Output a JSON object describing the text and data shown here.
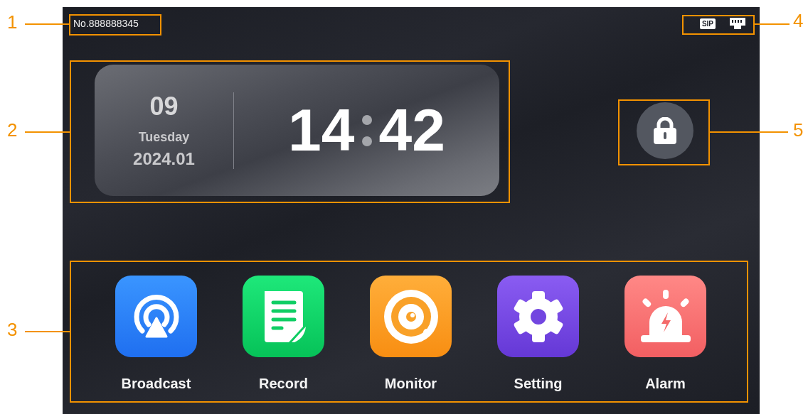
{
  "device_number": "No.888888345",
  "status_icons": [
    {
      "kind": "sip",
      "label": "SIP"
    },
    {
      "kind": "network"
    }
  ],
  "clock": {
    "day": "09",
    "weekday": "Tuesday",
    "year_month": "2024.01",
    "hour": "14",
    "minute": "42"
  },
  "apps": [
    {
      "kind": "broadcast",
      "label": "Broadcast"
    },
    {
      "kind": "record",
      "label": "Record"
    },
    {
      "kind": "monitor",
      "label": "Monitor"
    },
    {
      "kind": "setting",
      "label": "Setting"
    },
    {
      "kind": "alarm",
      "label": "Alarm"
    }
  ],
  "callouts": [
    {
      "number": "1"
    },
    {
      "number": "2"
    },
    {
      "number": "3"
    },
    {
      "number": "4"
    },
    {
      "number": "5"
    }
  ]
}
